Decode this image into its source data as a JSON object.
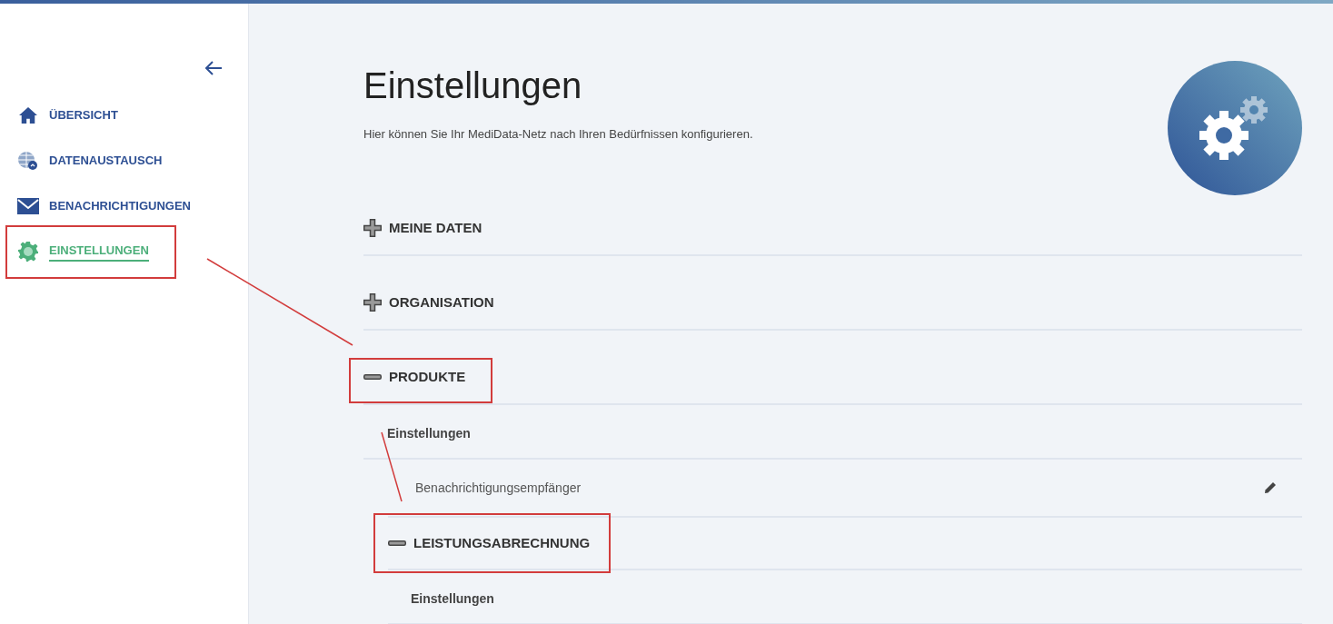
{
  "sidebar": {
    "items": [
      {
        "label": "ÜBERSICHT",
        "selected": false,
        "annotated": false
      },
      {
        "label": "DATENAUSTAUSCH",
        "selected": false,
        "annotated": false
      },
      {
        "label": "BENACHRICHTIGUNGEN",
        "selected": false,
        "annotated": false
      },
      {
        "label": "EINSTELLUNGEN",
        "selected": true,
        "annotated": true
      }
    ]
  },
  "page": {
    "title": "Einstellungen",
    "description": "Hier können Sie Ihr MediData-Netz nach Ihren Bedürfnissen konfigurieren."
  },
  "sections": [
    {
      "title": "MEINE DATEN",
      "expanded": false,
      "annotated": false
    },
    {
      "title": "ORGANISATION",
      "expanded": false,
      "annotated": false
    },
    {
      "title": "PRODUKTE",
      "expanded": true,
      "annotated": true,
      "children": [
        {
          "kind": "group",
          "label": "Einstellungen",
          "rows": [
            {
              "label": "Benachrichtigungsempfänger"
            }
          ]
        },
        {
          "kind": "section",
          "title": "LEISTUNGSABRECHNUNG",
          "expanded": true,
          "annotated": true,
          "children": [
            {
              "kind": "group",
              "label": "Einstellungen"
            }
          ]
        }
      ]
    }
  ]
}
